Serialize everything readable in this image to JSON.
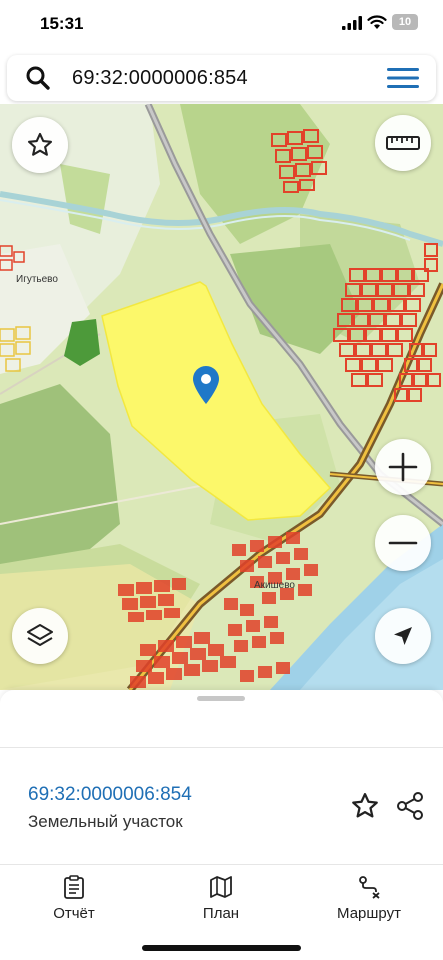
{
  "status_bar": {
    "time": "15:31",
    "battery": "10"
  },
  "search": {
    "query": "69:32:0000006:854"
  },
  "map": {
    "labels": {
      "village_1": "Игутьево",
      "village_2": "Акишево"
    },
    "parcel_color": "#fcf86a",
    "pin_color": "#1f78c8"
  },
  "sheet": {
    "parcel_id": "69:32:0000006:854",
    "parcel_type": "Земельный участок"
  },
  "bottom_nav": {
    "items": [
      {
        "label": "Отчёт",
        "icon": "report-icon"
      },
      {
        "label": "План",
        "icon": "map-plan-icon"
      },
      {
        "label": "Маршрут",
        "icon": "route-icon"
      }
    ]
  },
  "colors": {
    "accent": "#1f6fb5"
  }
}
